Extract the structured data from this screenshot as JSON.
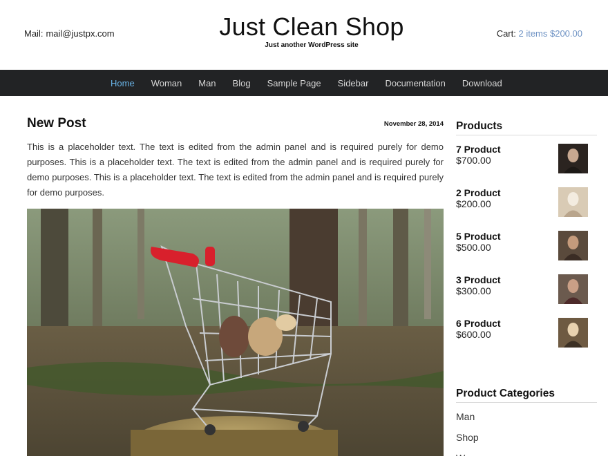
{
  "header": {
    "email_label": "Mail:",
    "email": "mail@justpx.com",
    "site_title": "Just Clean Shop",
    "tagline": "Just another WordPress site",
    "cart_label": "Cart:",
    "cart_link": "2 items $200.00"
  },
  "nav": {
    "items": [
      "Home",
      "Woman",
      "Man",
      "Blog",
      "Sample Page",
      "Sidebar",
      "Documentation",
      "Download"
    ],
    "active": "Home",
    "active_color": "#69b3e7",
    "bar_color": "#222325"
  },
  "post": {
    "title": "New Post",
    "date": "November 28, 2014",
    "body": "This is a placeholder text. The text is edited from the admin panel and is required purely for demo purposes. This is a placeholder text. The text is edited from the admin panel and is required purely for demo purposes. This is a placeholder text. The text is edited from the admin panel and is required purely for demo purposes."
  },
  "sidebar": {
    "products_title": "Products",
    "products": [
      {
        "name": "7 Product",
        "price": "$700.00"
      },
      {
        "name": "2 Product",
        "price": "$200.00"
      },
      {
        "name": "5 Product",
        "price": "$500.00"
      },
      {
        "name": "3 Product",
        "price": "$300.00"
      },
      {
        "name": "6 Product",
        "price": "$600.00"
      }
    ],
    "categories_title": "Product Categories",
    "categories": [
      "Man",
      "Shop",
      "Woman"
    ]
  },
  "colors": {
    "link": "#6f93c4"
  }
}
